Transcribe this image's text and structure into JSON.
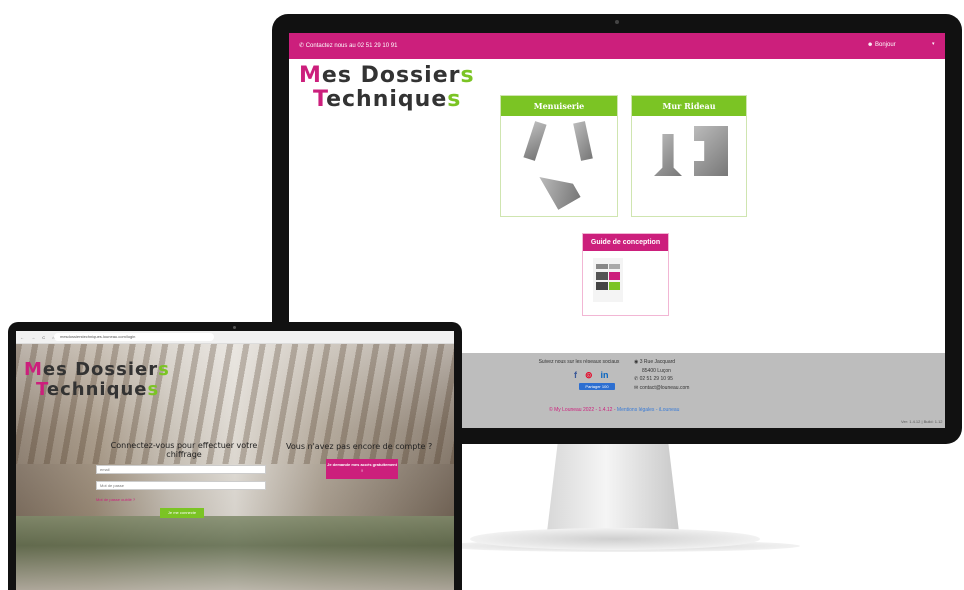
{
  "desktop": {
    "topbar": {
      "contact": "Contactez nous au 02 51 29 10 91",
      "user": "Bonjour",
      "caret": "▾"
    },
    "logo": {
      "m": "M",
      "line1": "es Dossier",
      "s1": "s",
      "t": "T",
      "line2": "echnique",
      "s2": "s"
    },
    "cards": {
      "menuiserie": "Menuiserie",
      "mur_rideau": "Mur Rideau",
      "guide": "Guide de conception"
    },
    "footer": {
      "social_label": "Suivez nous sur les réseaux sociaux",
      "icons": [
        "f",
        "⊚",
        "in"
      ],
      "share": "Partager 100",
      "address1": "3 Rue Jacquard",
      "address2": "85400 Luçon",
      "phone": "02 51 29 10 95",
      "email": "contact@louneau.com",
      "copyright": "© My Louneau 2022 - 1.4.12 -",
      "legal_link": "Mentions légales - iLouneau",
      "version": "Ver: 1.4.12 | Build: 1.12"
    }
  },
  "laptop": {
    "url": "mesdossierstechniques.louneau.com/login",
    "nav": "← → C ⌂",
    "logo": {
      "m": "M",
      "line1": "es Dossier",
      "s1": "s",
      "t": "T",
      "line2": "echnique",
      "s2": "s"
    },
    "login_title": "Connectez-vous pour effectuer votre chiffrage",
    "email_placeholder": "email",
    "password_placeholder": "Mot de passe",
    "forgot": "Mot de passe oublié ?",
    "login_button": "Je me connecte",
    "signup_title": "Vous n'avez pas encore de compte ?",
    "signup_button": "Je demande mes accès gratuitement !"
  },
  "colors": {
    "brand_pink": "#cc1f7c",
    "brand_green": "#7bc424"
  }
}
